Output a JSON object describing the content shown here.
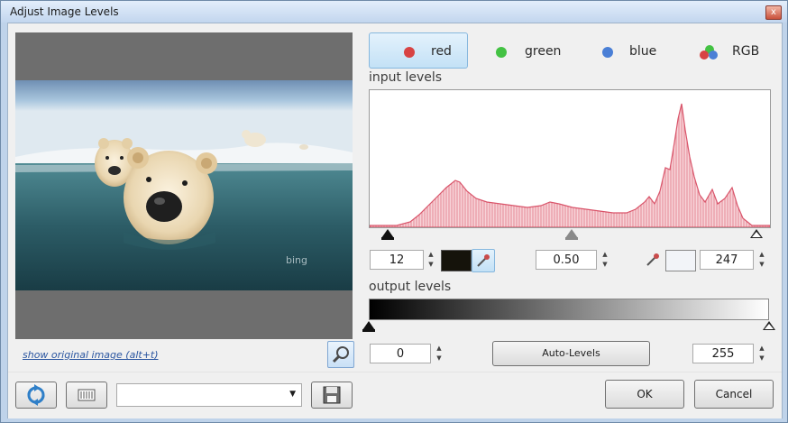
{
  "window": {
    "title": "Adjust Image Levels",
    "close_glyph": "x"
  },
  "preview": {
    "show_original_label": "show original image (alt+t)",
    "watermark": "bing"
  },
  "channels": [
    {
      "label": "red",
      "color": "#d84343",
      "active": true
    },
    {
      "label": "green",
      "color": "#43c243",
      "active": false
    },
    {
      "label": "blue",
      "color": "#4a7fd6",
      "active": false
    },
    {
      "label": "RGB",
      "colors": [
        "#43c243",
        "#d84343",
        "#4a7fd6"
      ],
      "active": false
    }
  ],
  "input_levels": {
    "label": "input levels",
    "black_point": "12",
    "gamma": "0.50",
    "white_point": "247",
    "histogram_color": "#e58a96"
  },
  "output_levels": {
    "label": "output levels",
    "black": "0",
    "white": "255"
  },
  "buttons": {
    "auto_levels": "Auto-Levels",
    "ok": "OK",
    "cancel": "Cancel"
  },
  "preset": {
    "value": ""
  },
  "icons": {
    "refresh": "refresh-icon",
    "toggle": "grid-toggle-icon",
    "save": "save-preset-icon",
    "zoom": "zoom-fit-icon",
    "eyedropper": "eyedropper-icon"
  }
}
